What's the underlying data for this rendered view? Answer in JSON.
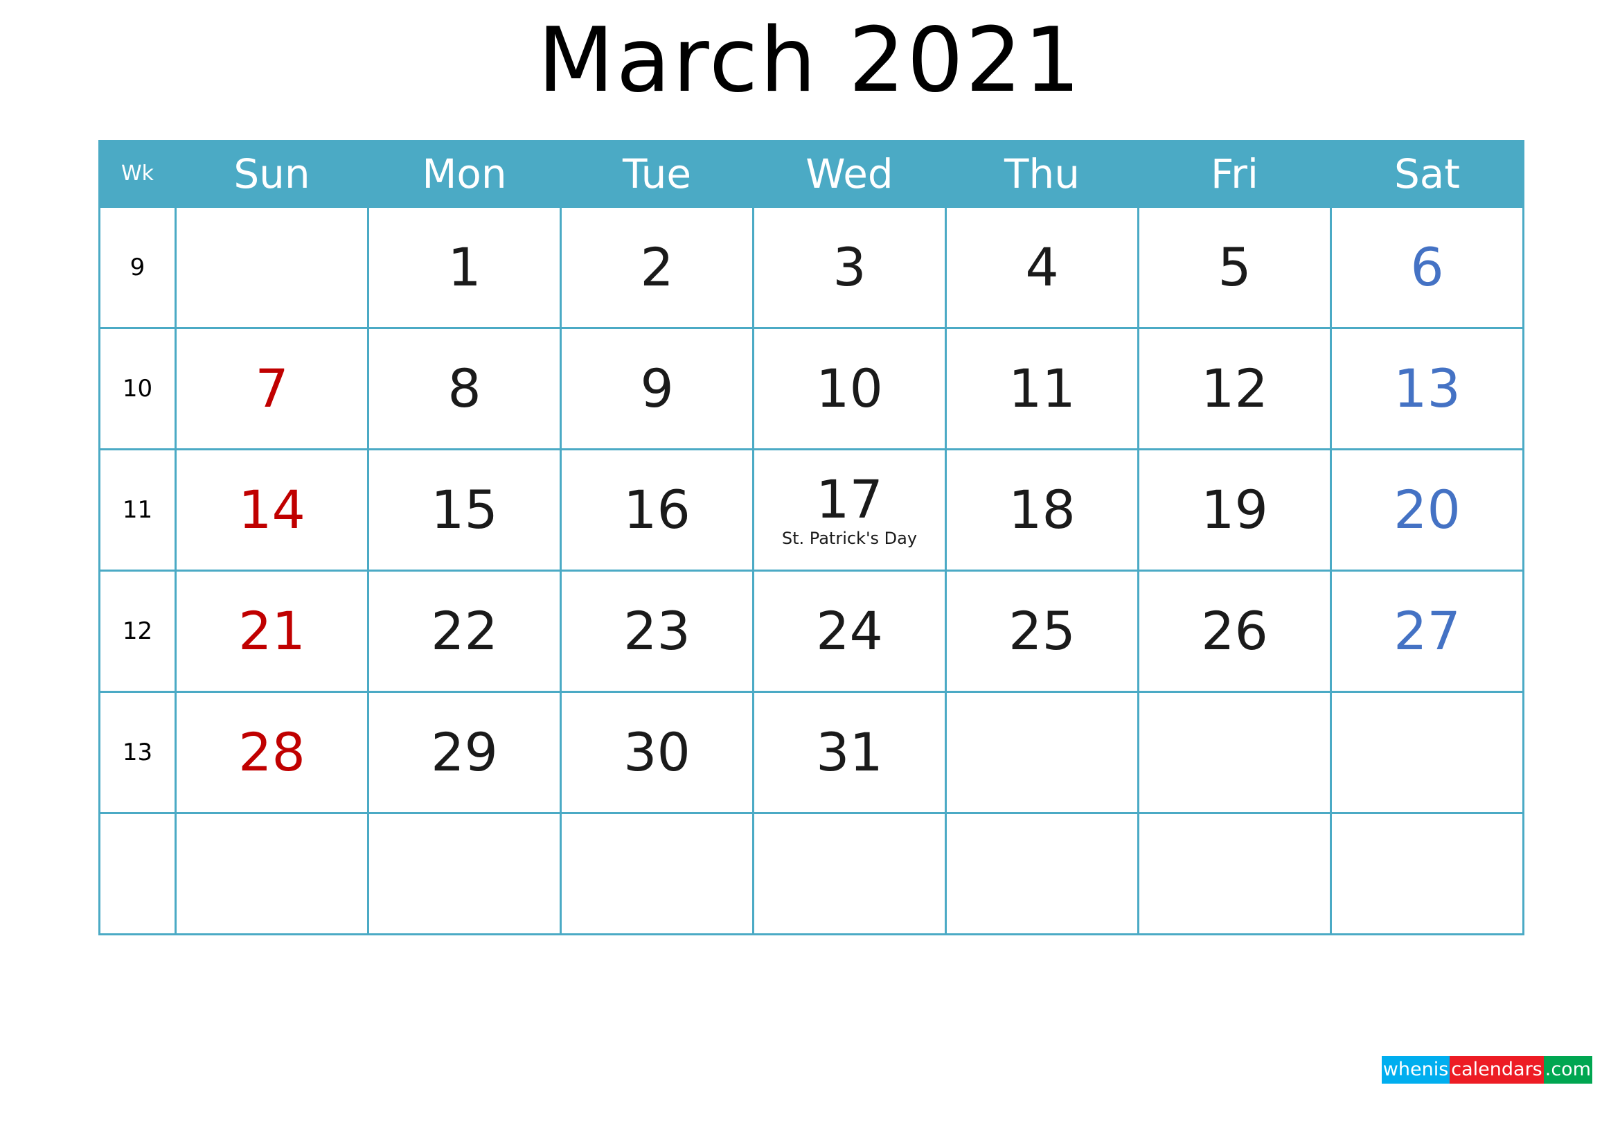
{
  "title": "March 2021",
  "colors": {
    "header_bg": "#4BAAC5",
    "grid_line": "#4BAAC5",
    "sunday": "#C00000",
    "saturday": "#4472C4",
    "weekday": "#1a1a1a",
    "logo_blue": "#00AEEF",
    "logo_red": "#ED1C24",
    "logo_green": "#00A651"
  },
  "header": {
    "wk_label": "Wk",
    "days": [
      "Sun",
      "Mon",
      "Tue",
      "Wed",
      "Thu",
      "Fri",
      "Sat"
    ]
  },
  "weeks": [
    {
      "wk": "9",
      "days": [
        {
          "num": "",
          "event": ""
        },
        {
          "num": "1",
          "event": ""
        },
        {
          "num": "2",
          "event": ""
        },
        {
          "num": "3",
          "event": ""
        },
        {
          "num": "4",
          "event": ""
        },
        {
          "num": "5",
          "event": ""
        },
        {
          "num": "6",
          "event": ""
        }
      ]
    },
    {
      "wk": "10",
      "days": [
        {
          "num": "7",
          "event": ""
        },
        {
          "num": "8",
          "event": ""
        },
        {
          "num": "9",
          "event": ""
        },
        {
          "num": "10",
          "event": ""
        },
        {
          "num": "11",
          "event": ""
        },
        {
          "num": "12",
          "event": ""
        },
        {
          "num": "13",
          "event": ""
        }
      ]
    },
    {
      "wk": "11",
      "days": [
        {
          "num": "14",
          "event": ""
        },
        {
          "num": "15",
          "event": ""
        },
        {
          "num": "16",
          "event": ""
        },
        {
          "num": "17",
          "event": "St. Patrick's Day"
        },
        {
          "num": "18",
          "event": ""
        },
        {
          "num": "19",
          "event": ""
        },
        {
          "num": "20",
          "event": ""
        }
      ]
    },
    {
      "wk": "12",
      "days": [
        {
          "num": "21",
          "event": ""
        },
        {
          "num": "22",
          "event": ""
        },
        {
          "num": "23",
          "event": ""
        },
        {
          "num": "24",
          "event": ""
        },
        {
          "num": "25",
          "event": ""
        },
        {
          "num": "26",
          "event": ""
        },
        {
          "num": "27",
          "event": ""
        }
      ]
    },
    {
      "wk": "13",
      "days": [
        {
          "num": "28",
          "event": ""
        },
        {
          "num": "29",
          "event": ""
        },
        {
          "num": "30",
          "event": ""
        },
        {
          "num": "31",
          "event": ""
        },
        {
          "num": "",
          "event": ""
        },
        {
          "num": "",
          "event": ""
        },
        {
          "num": "",
          "event": ""
        }
      ]
    },
    {
      "wk": "",
      "days": [
        {
          "num": "",
          "event": ""
        },
        {
          "num": "",
          "event": ""
        },
        {
          "num": "",
          "event": ""
        },
        {
          "num": "",
          "event": ""
        },
        {
          "num": "",
          "event": ""
        },
        {
          "num": "",
          "event": ""
        },
        {
          "num": "",
          "event": ""
        }
      ]
    }
  ],
  "logo": {
    "part_blue": "whenis",
    "part_red": "calendars",
    "part_green": ".com"
  }
}
